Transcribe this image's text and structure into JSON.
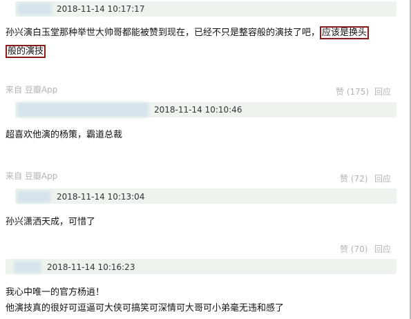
{
  "comments": [
    {
      "timestamp": "2018-11-14 10:17:17",
      "line1_plain": "孙兴演白玉堂那种举世大帅哥都能被赞到现在，已经不只是整容般的演技了吧，",
      "line1_highlight": "应该是换头",
      "line2_highlight": "般的演技",
      "source": "来自 豆瓣App",
      "likes": "赞 (175)",
      "reply": "回应"
    },
    {
      "timestamp": "2018-11-14 10:10:46",
      "line1": "超喜欢他演的杨策，霸道总裁",
      "source": "来自 豆瓣App",
      "likes": "赞 (72)",
      "reply": "回应"
    },
    {
      "timestamp": "2018-11-14 10:13:04",
      "line1": "孙兴潇洒天成，可惜了",
      "likes": "赞 (70)",
      "reply": "回应"
    },
    {
      "timestamp": "2018-11-14 10:16:23",
      "line1": "我心中唯一的官方杨逍！",
      "line2": "他演技真的很好可逗逼可大侠可搞笑可深情可大哥可小弟毫无违和感了"
    }
  ]
}
